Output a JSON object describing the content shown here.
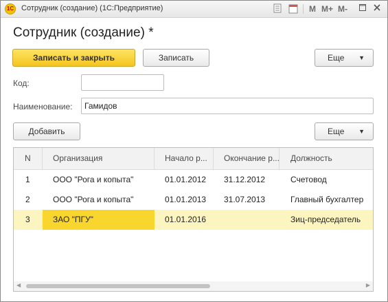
{
  "window": {
    "title": "Сотрудник (создание)  (1С:Предприятие)",
    "toolbar": {
      "m_label": "M",
      "mplus_label": "M+",
      "mminus_label": "M-",
      "calendar_label": "31"
    },
    "icons": [
      "app-logo-icon",
      "document-icon",
      "calendar-icon",
      "maximize-icon",
      "close-icon"
    ]
  },
  "form": {
    "heading": "Сотрудник (создание) *",
    "command_bar": {
      "save_close": "Записать и закрыть",
      "save": "Записать",
      "more": "Еще"
    },
    "code": {
      "label": "Код:",
      "value": ""
    },
    "name": {
      "label": "Наименование:",
      "value": "Гамидов"
    }
  },
  "table": {
    "add_label": "Добавить",
    "more_label": "Еще",
    "columns": [
      "N",
      "Организация",
      "Начало р...",
      "Окончание р...",
      "Должность"
    ],
    "rows": [
      {
        "n": "1",
        "org": "ООО \"Рога и копыта\"",
        "start": "01.01.2012",
        "end": "31.12.2012",
        "position": "Счетовод"
      },
      {
        "n": "2",
        "org": "ООО \"Рога и копыта\"",
        "start": "01.01.2013",
        "end": "31.07.2013",
        "position": "Главный бухгалтер"
      },
      {
        "n": "3",
        "org": "ЗАО \"ПГУ\"",
        "start": "01.01.2016",
        "end": "",
        "position": "Зиц-председатель"
      }
    ],
    "selected_row": 3
  },
  "colors": {
    "primary_button": "#f5c51f",
    "selected_row": "#fdf5c0",
    "current_cell": "#f8d62e"
  }
}
